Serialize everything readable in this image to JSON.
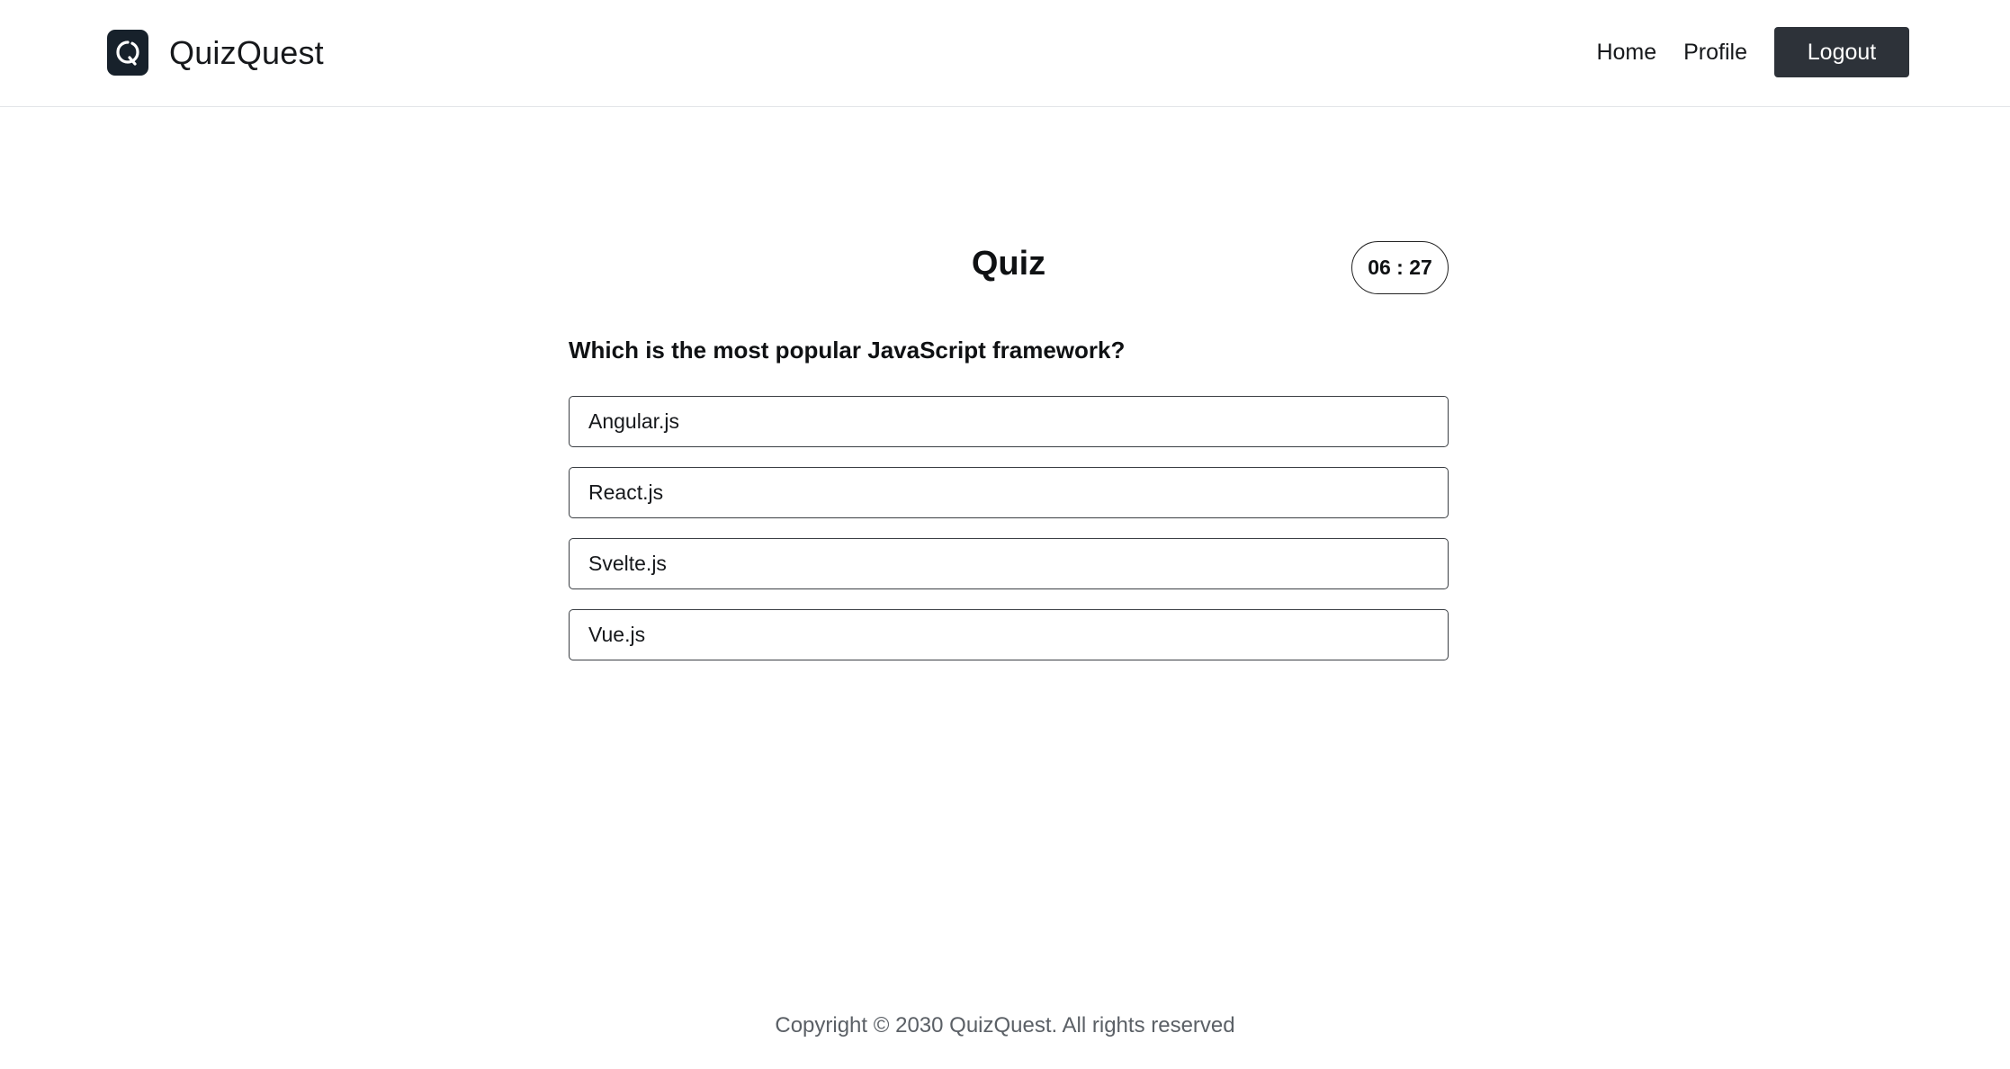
{
  "header": {
    "brand_name": "QuizQuest",
    "logo_icon": "quizquest-logo-icon",
    "nav": {
      "home_label": "Home",
      "profile_label": "Profile",
      "logout_label": "Logout"
    }
  },
  "quiz": {
    "title": "Quiz",
    "timer": "06 : 27",
    "question": "Which is the most popular JavaScript framework?",
    "options": [
      {
        "label": "Angular.js"
      },
      {
        "label": "React.js"
      },
      {
        "label": "Svelte.js"
      },
      {
        "label": "Vue.js"
      }
    ]
  },
  "footer": {
    "copyright": "Copyright © 2030 QuizQuest. All rights reserved"
  },
  "colors": {
    "logout_button": "#2d3239",
    "logo_background": "#17212b",
    "header_border": "#e3e5e8",
    "footer_text": "#5b6066"
  }
}
